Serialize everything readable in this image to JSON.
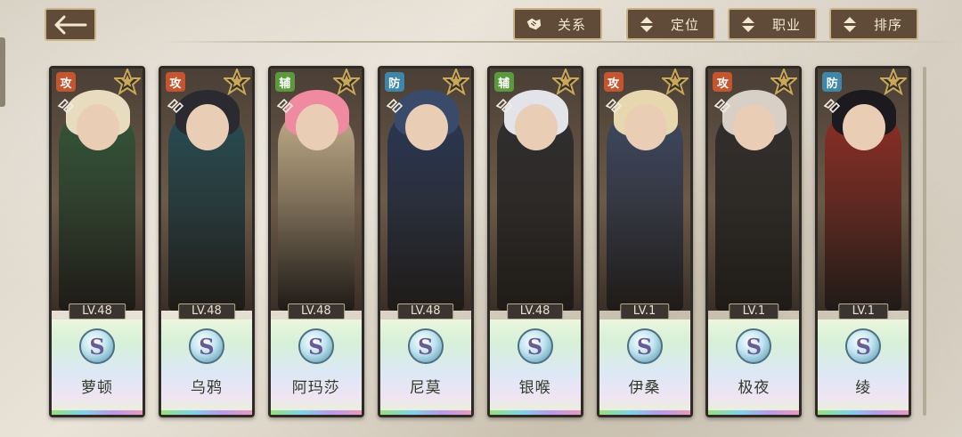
{
  "topbar": {
    "buttons": [
      {
        "label": "关系",
        "icon": "handshake-icon"
      },
      {
        "label": "定位",
        "icon": "sort-icon"
      },
      {
        "label": "职业",
        "icon": "sort-icon"
      },
      {
        "label": "排序",
        "icon": "sort-icon"
      }
    ]
  },
  "colors": {
    "attack": "#c4552f",
    "support": "#5a9a3c",
    "defense": "#3f87a8",
    "frame": "#5f4b38",
    "gold": "#c9b48a"
  },
  "cards": [
    {
      "role": "攻",
      "role_type": "attack",
      "level": "LV.48",
      "rank": "S",
      "name": "萝顿",
      "hair": "#e8dcc0",
      "coat": "#2f5a3a"
    },
    {
      "role": "攻",
      "role_type": "attack",
      "level": "LV.48",
      "rank": "S",
      "name": "乌鸦",
      "hair": "#2a2a30",
      "coat": "#1f4f5a"
    },
    {
      "role": "辅",
      "role_type": "support",
      "level": "LV.48",
      "rank": "S",
      "name": "阿玛莎",
      "hair": "#f08aa0",
      "coat": "#d9c29a"
    },
    {
      "role": "防",
      "role_type": "defense",
      "level": "LV.48",
      "rank": "S",
      "name": "尼莫",
      "hair": "#3a4a6a",
      "coat": "#22355a"
    },
    {
      "role": "辅",
      "role_type": "support",
      "level": "LV.48",
      "rank": "S",
      "name": "银喉",
      "hair": "#e2e4ea",
      "coat": "#2a2a2e"
    },
    {
      "role": "攻",
      "role_type": "attack",
      "level": "LV.1",
      "rank": "S",
      "name": "伊桑",
      "hair": "#e6d7ae",
      "coat": "#3b4a6a"
    },
    {
      "role": "攻",
      "role_type": "attack",
      "level": "LV.1",
      "rank": "S",
      "name": "极夜",
      "hair": "#d8d0c6",
      "coat": "#2b2b2b"
    },
    {
      "role": "防",
      "role_type": "defense",
      "level": "LV.1",
      "rank": "S",
      "name": "绫",
      "hair": "#1c1a1e",
      "coat": "#9a2a22"
    }
  ]
}
